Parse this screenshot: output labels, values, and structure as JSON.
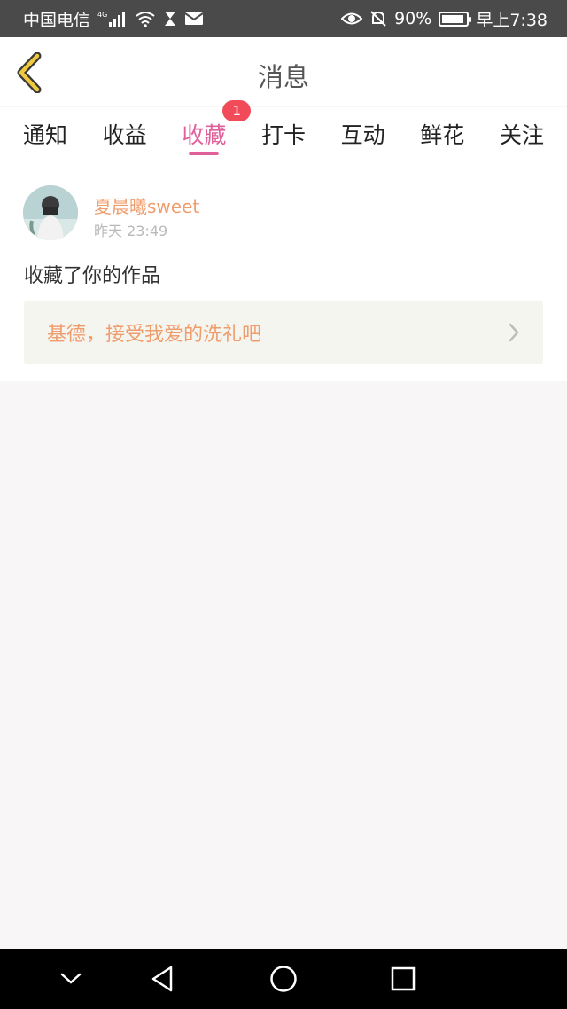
{
  "status_bar": {
    "carrier": "中国电信",
    "network": "4G",
    "battery_percent": "90%",
    "battery_level": 0.9,
    "time": "早上7:38"
  },
  "header": {
    "title": "消息",
    "back_icon": "chevron-left-icon",
    "accent_color": "#f0c93e"
  },
  "tabs": [
    {
      "label": "通知",
      "active": false
    },
    {
      "label": "收益",
      "active": false
    },
    {
      "label": "收藏",
      "active": true,
      "badge": "1"
    },
    {
      "label": "打卡",
      "active": false
    },
    {
      "label": "互动",
      "active": false
    },
    {
      "label": "鲜花",
      "active": false
    },
    {
      "label": "关注",
      "active": false
    }
  ],
  "message": {
    "sender": "夏晨曦sweet",
    "time": "昨天 23:49",
    "text": "收藏了你的作品",
    "work_title": "基德，接受我爱的洗礼吧"
  },
  "colors": {
    "active_tab": "#e0609b",
    "badge": "#f14b5a",
    "name_text": "#f09d6e",
    "link_bg": "#f5f5ef"
  },
  "nav_bar": {
    "buttons": [
      "chevron-down-icon",
      "back-triangle-icon",
      "home-circle-icon",
      "recents-square-icon"
    ]
  }
}
